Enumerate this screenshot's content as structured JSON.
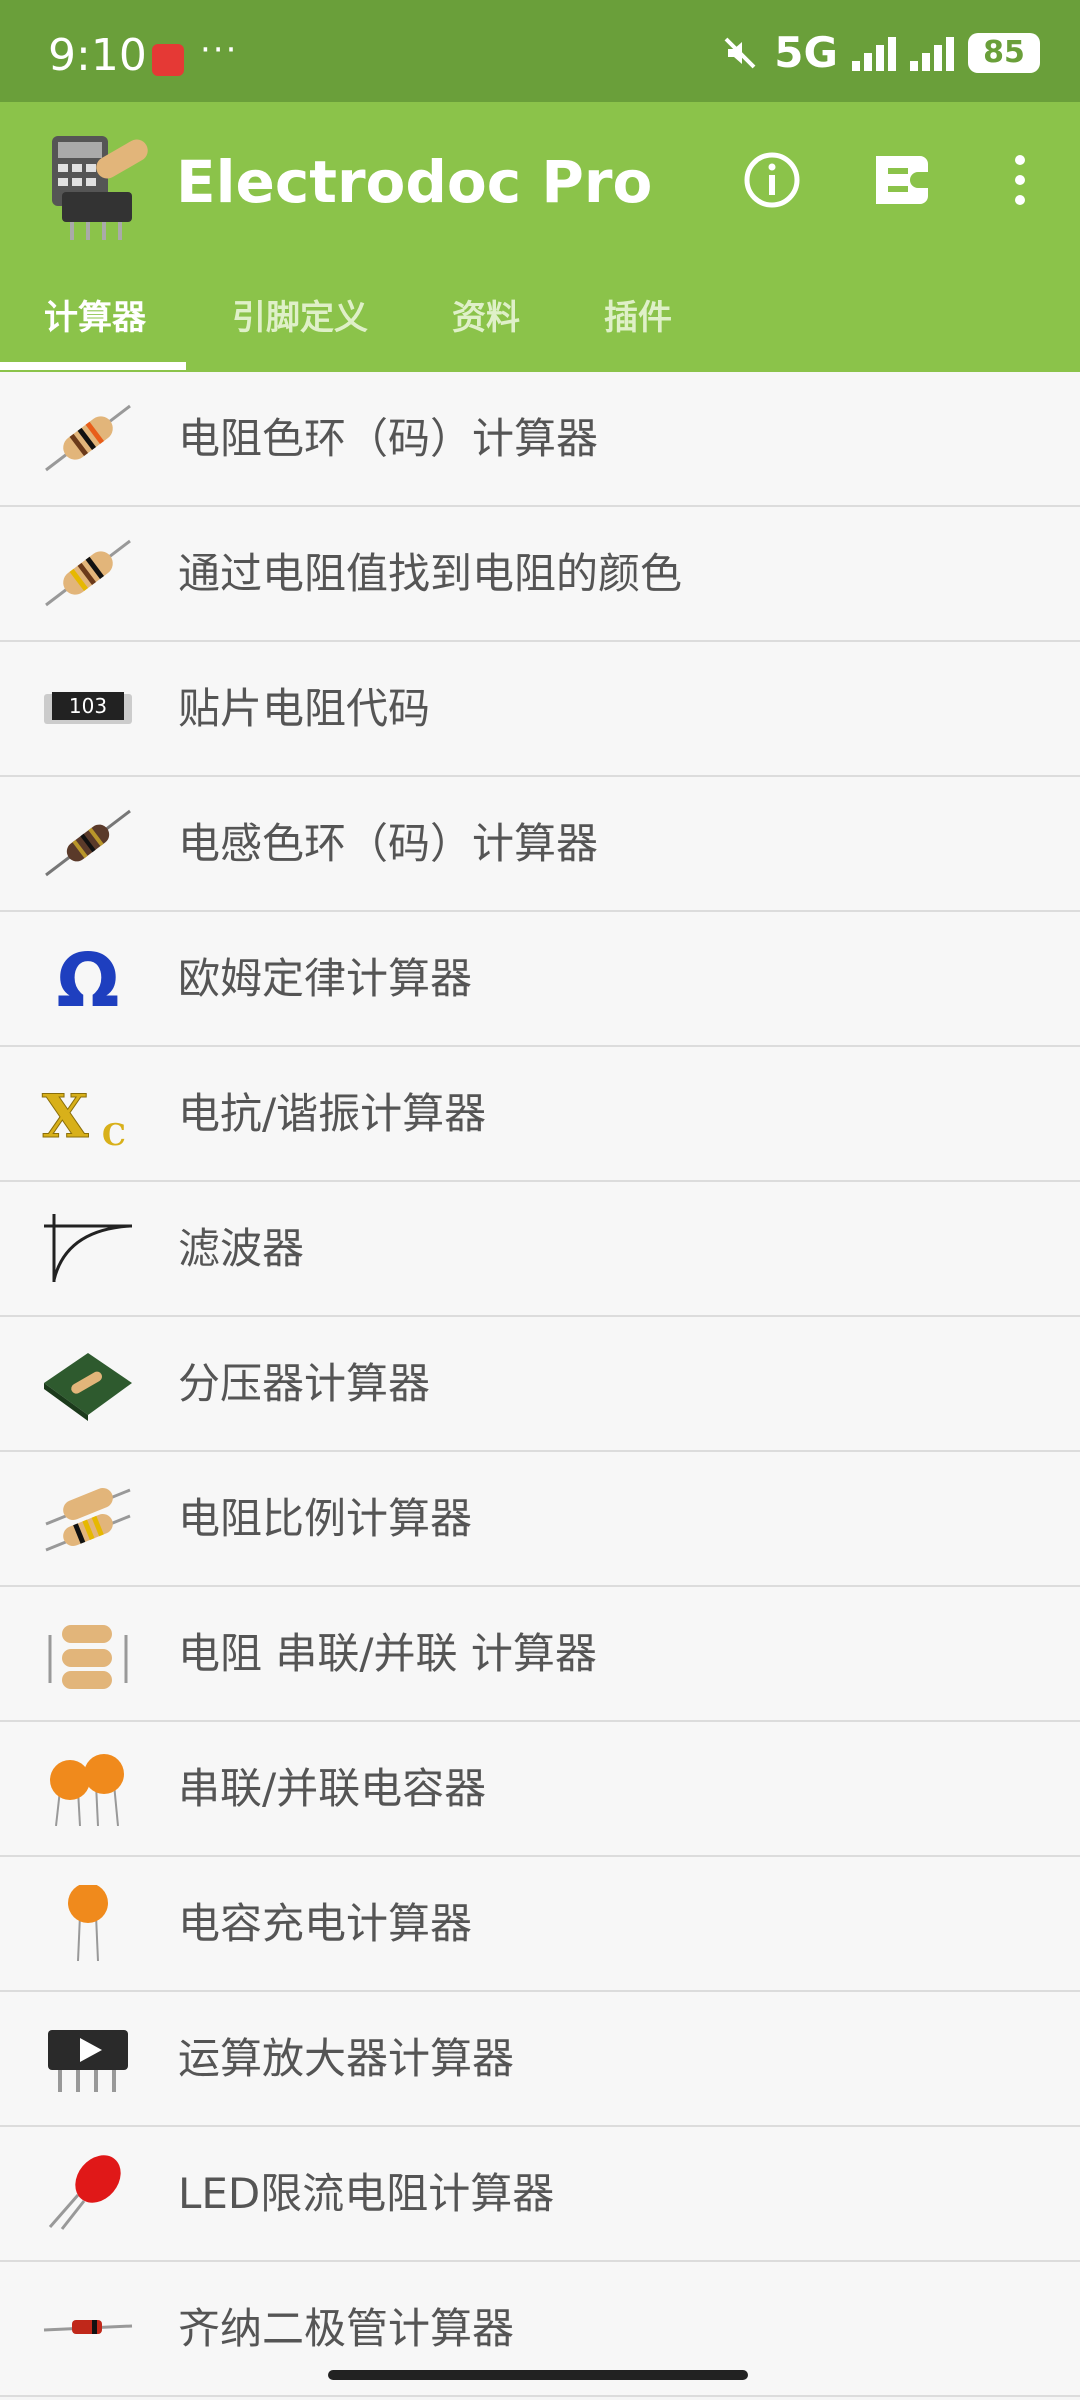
{
  "status_bar": {
    "time": "9:10",
    "dots": "···",
    "network": "5G",
    "battery": "85"
  },
  "app_bar": {
    "title": "Electrodoc Pro",
    "tabs": [
      {
        "label": "计算器"
      },
      {
        "label": "引脚定义"
      },
      {
        "label": "资料"
      },
      {
        "label": "插件"
      }
    ]
  },
  "list": [
    {
      "label": "电阻色环（码）计算器",
      "icon": "resistor-icon"
    },
    {
      "label": "通过电阻值找到电阻的颜色",
      "icon": "resistor-icon"
    },
    {
      "label": "贴片电阻代码",
      "icon": "smd-resistor-icon",
      "icon_text": "103"
    },
    {
      "label": "电感色环（码）计算器",
      "icon": "inductor-icon"
    },
    {
      "label": "欧姆定律计算器",
      "icon": "ohm-icon",
      "icon_text": "Ω"
    },
    {
      "label": "电抗/谐振计算器",
      "icon": "reactance-icon",
      "icon_text": "X",
      "icon_sub": "C"
    },
    {
      "label": "滤波器",
      "icon": "filter-curve-icon"
    },
    {
      "label": "分压器计算器",
      "icon": "pcb-divider-icon"
    },
    {
      "label": "电阻比例计算器",
      "icon": "resistor-pair-icon"
    },
    {
      "label": "电阻 串联/并联 计算器",
      "icon": "resistor-network-icon"
    },
    {
      "label": "串联/并联电容器",
      "icon": "capacitor-pair-icon"
    },
    {
      "label": "电容充电计算器",
      "icon": "capacitor-icon"
    },
    {
      "label": "运算放大器计算器",
      "icon": "opamp-chip-icon"
    },
    {
      "label": "LED限流电阻计算器",
      "icon": "led-icon"
    },
    {
      "label": "齐纳二极管计算器",
      "icon": "zener-diode-icon"
    }
  ],
  "colors": {
    "status_bar": "#6a9f3a",
    "app_bar": "#8bc34a",
    "list_bg": "#f7f7f7",
    "divider": "#dcdcdc",
    "text": "#555555"
  }
}
